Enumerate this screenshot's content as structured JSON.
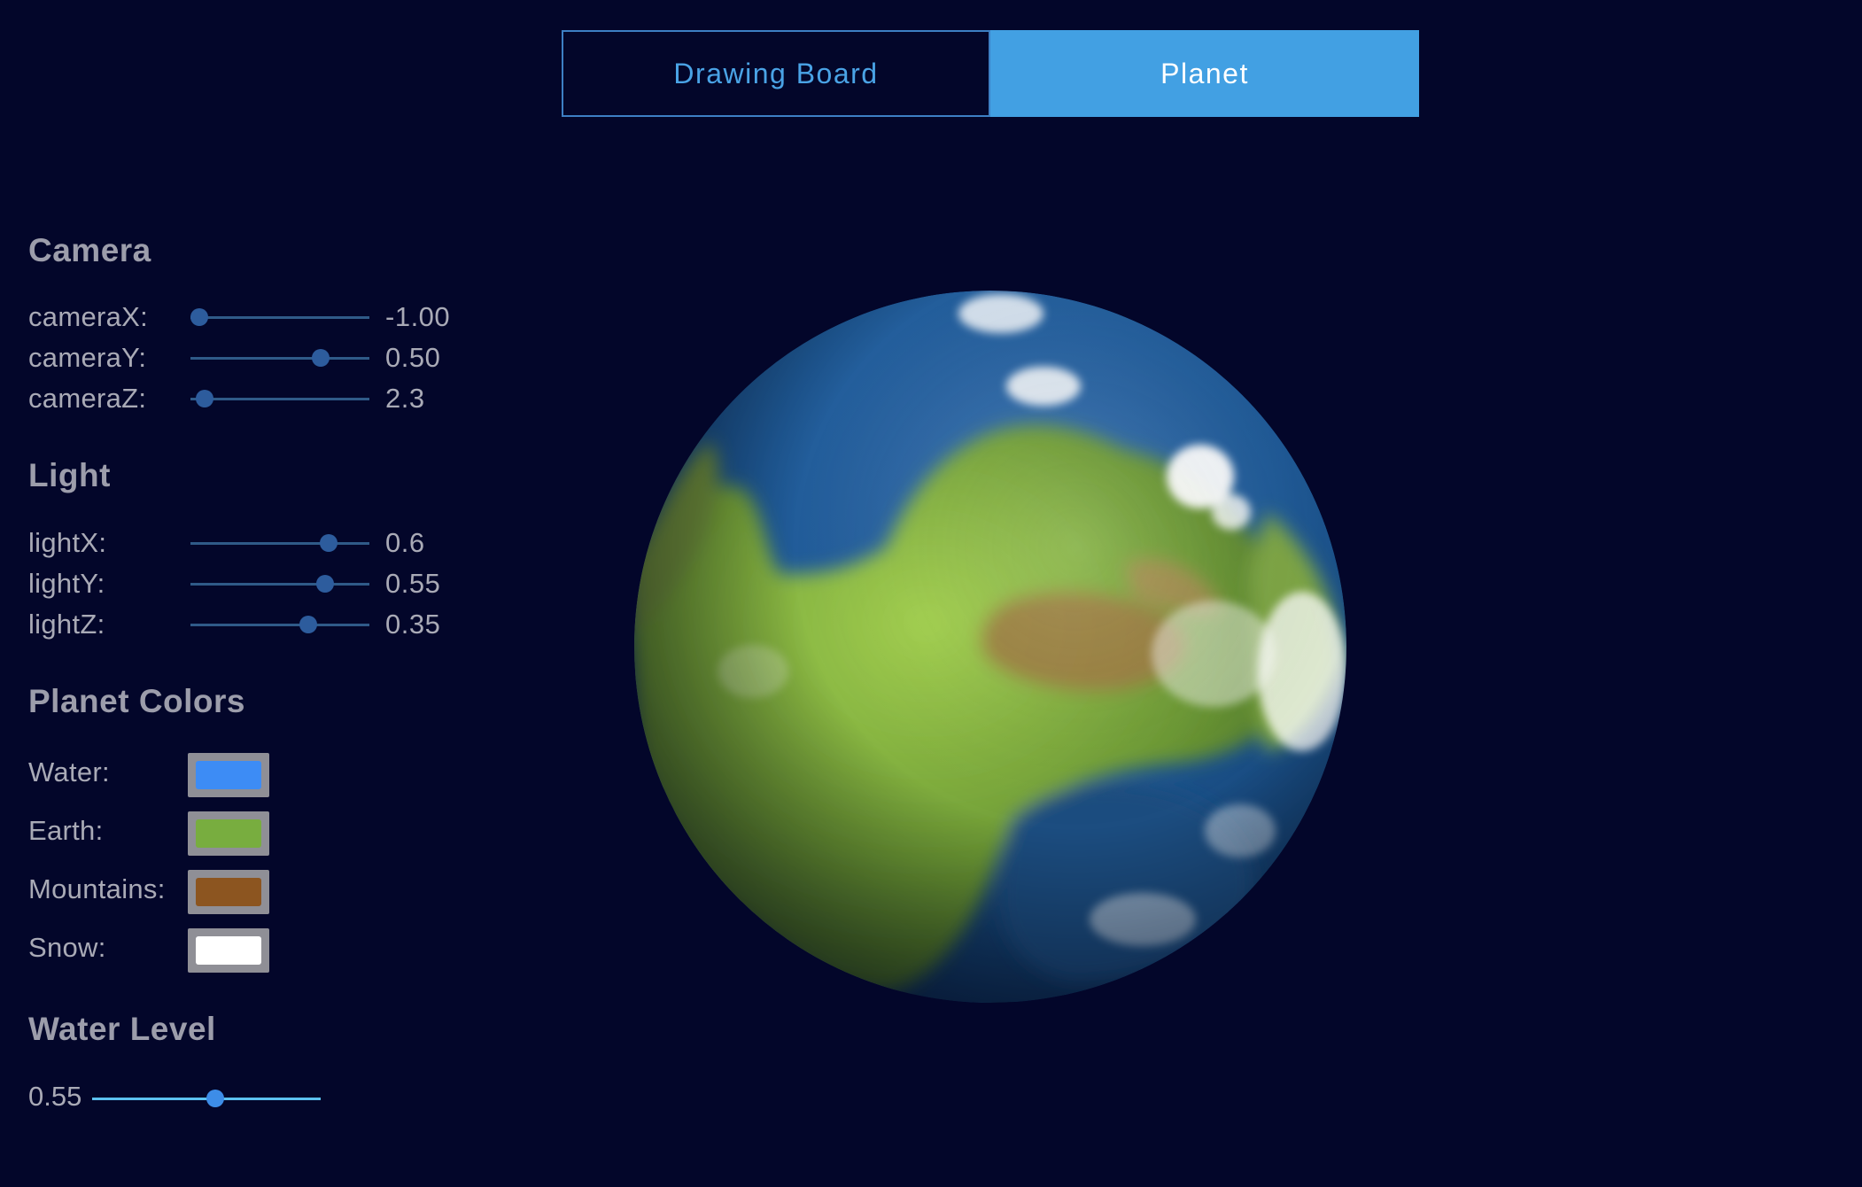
{
  "tabs": [
    {
      "label": "Drawing Board",
      "active": false
    },
    {
      "label": "Planet",
      "active": true
    }
  ],
  "camera": {
    "heading": "Camera",
    "sliders": [
      {
        "label": "cameraX:",
        "value": "-1.00",
        "fraction": 0.05
      },
      {
        "label": "cameraY:",
        "value": "0.50",
        "fraction": 0.73
      },
      {
        "label": "cameraZ:",
        "value": "2.3",
        "fraction": 0.08
      }
    ]
  },
  "light": {
    "heading": "Light",
    "sliders": [
      {
        "label": "lightX:",
        "value": "0.6",
        "fraction": 0.77
      },
      {
        "label": "lightY:",
        "value": "0.55",
        "fraction": 0.75
      },
      {
        "label": "lightZ:",
        "value": "0.35",
        "fraction": 0.66
      }
    ]
  },
  "planet_colors": {
    "heading": "Planet Colors",
    "items": [
      {
        "label": "Water:",
        "color": "#3d8cf5"
      },
      {
        "label": "Earth:",
        "color": "#78ad3f"
      },
      {
        "label": "Mountains:",
        "color": "#8c5520"
      },
      {
        "label": "Snow:",
        "color": "#ffffff"
      }
    ]
  },
  "water_level": {
    "heading": "Water Level",
    "value": "0.55",
    "fraction": 0.54
  }
}
